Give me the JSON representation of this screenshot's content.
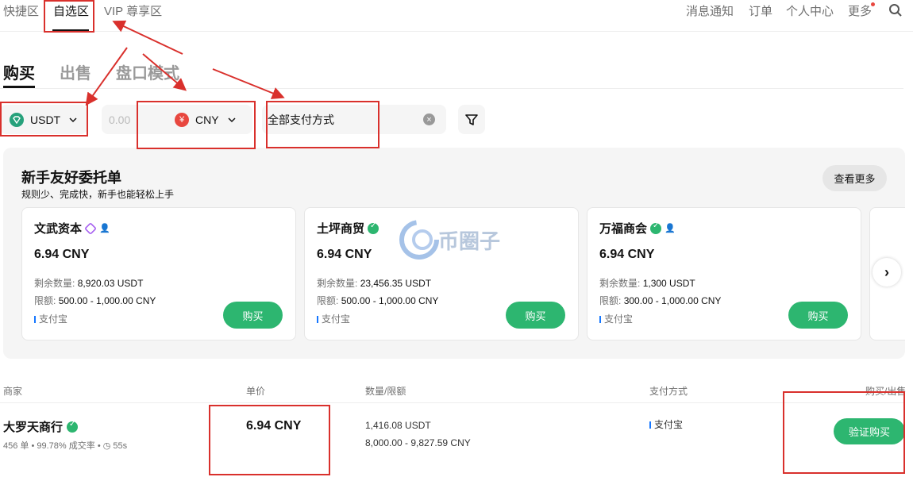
{
  "topnav": {
    "tabs": [
      "快捷区",
      "自选区",
      "VIP 尊享区"
    ],
    "right": [
      "消息通知",
      "订单",
      "个人中心",
      "更多"
    ]
  },
  "mode_tabs": [
    "购买",
    "出售",
    "盘口模式"
  ],
  "filters": {
    "coin": "USDT",
    "amount_placeholder": "0.00",
    "fiat": "CNY",
    "fiat_symbol": "¥",
    "payment": "全部支付方式"
  },
  "panel": {
    "title": "新手友好委托单",
    "subtitle": "规则少、完成快，新手也能轻松上手",
    "more": "查看更多",
    "cards": [
      {
        "name": "文武资本",
        "price": "6.94 CNY",
        "remain_label": "剩余数量:",
        "remain": "8,920.03 USDT",
        "limit_label": "限额:",
        "limit": "500.00 - 1,000.00 CNY",
        "pay": "支付宝",
        "buy": "购买"
      },
      {
        "name": "土坪商贸",
        "price": "6.94 CNY",
        "remain_label": "剩余数量:",
        "remain": "23,456.35 USDT",
        "limit_label": "限额:",
        "limit": "500.00 - 1,000.00 CNY",
        "pay": "支付宝",
        "buy": "购买"
      },
      {
        "name": "万福商会",
        "price": "6.94 CNY",
        "remain_label": "剩余数量:",
        "remain": "1,300 USDT",
        "limit_label": "限额:",
        "limit": "300.00 - 1,000.00 CNY",
        "pay": "支付宝",
        "buy": "购买"
      }
    ]
  },
  "watermark": "币圈子",
  "table": {
    "headers": [
      "商家",
      "单价",
      "数量/限额",
      "支付方式",
      "购买/出售"
    ],
    "rows": [
      {
        "merchant": "大罗天商行",
        "orders": "456 单",
        "rate": "99.78% 成交率",
        "time": "55s",
        "price": "6.94 CNY",
        "qty": "1,416.08 USDT",
        "limit": "8,000.00 - 9,827.59 CNY",
        "pay": "支付宝",
        "action": "验证购买"
      }
    ]
  }
}
